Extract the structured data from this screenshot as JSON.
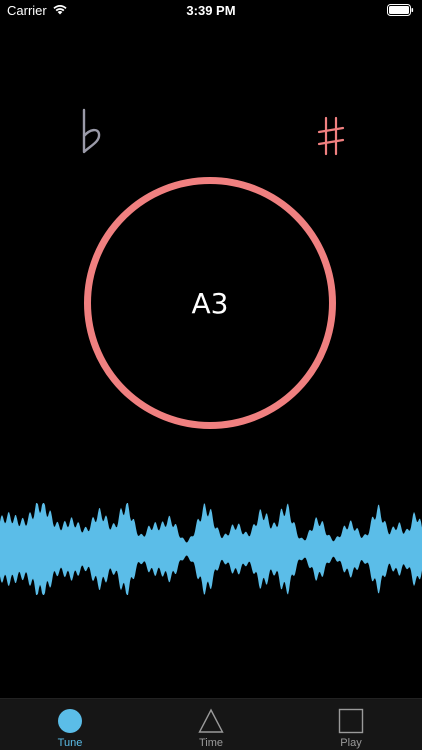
{
  "status_bar": {
    "carrier": "Carrier",
    "time": "3:39 PM",
    "icons": [
      "wifi-icon",
      "battery-icon"
    ]
  },
  "tuner": {
    "note": "A3",
    "flat_icon": "flat-sign-icon",
    "sharp_icon": "sharp-sign-icon"
  },
  "tabs": [
    {
      "label": "Tune",
      "icon": "circle-icon",
      "active": true
    },
    {
      "label": "Time",
      "icon": "triangle-icon",
      "active": false
    },
    {
      "label": "Play",
      "icon": "square-icon",
      "active": false
    }
  ],
  "colors": {
    "background": "#000000",
    "accent_red": "#F08080",
    "accent_blue": "#5BBDE8",
    "flat_sign": "#9a9aa8",
    "tab_bar": "#161616",
    "inactive_tab": "#9a9a9a"
  }
}
